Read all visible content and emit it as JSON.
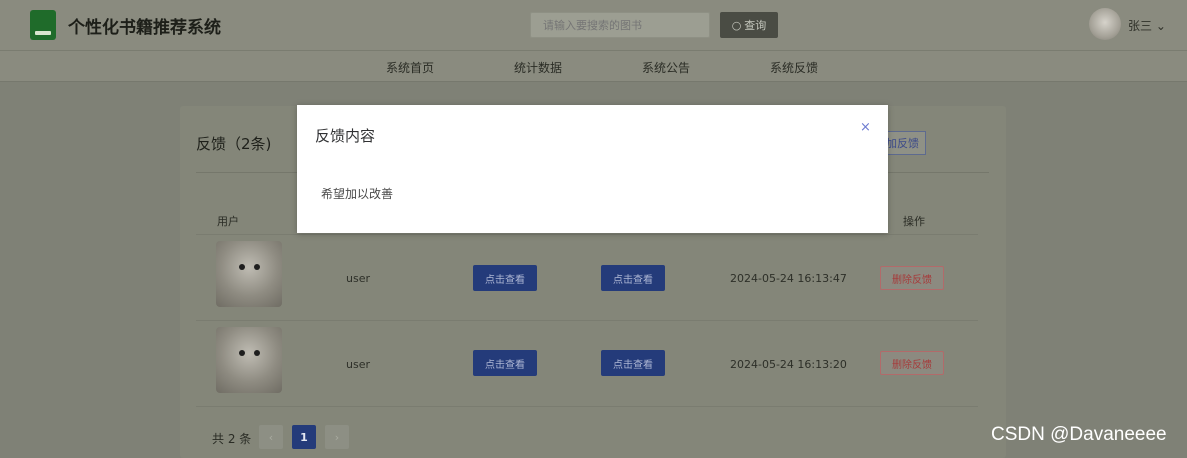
{
  "header": {
    "app_title": "个性化书籍推荐系统",
    "search_placeholder": "请输入要搜索的图书",
    "search_button": "查询",
    "user_name": "张三",
    "user_caret": "⌄"
  },
  "nav": {
    "items": [
      "系统首页",
      "统计数据",
      "系统公告",
      "系统反馈"
    ]
  },
  "card": {
    "title": "反馈（2条)",
    "add_button": "添加反馈",
    "columns": [
      "用户",
      "操作"
    ]
  },
  "rows": [
    {
      "user": "user",
      "view1": "点击查看",
      "view2": "点击查看",
      "time": "2024-05-24 16:13:47",
      "delete": "删除反馈"
    },
    {
      "user": "user",
      "view1": "点击查看",
      "view2": "点击查看",
      "time": "2024-05-24 16:13:20",
      "delete": "删除反馈"
    }
  ],
  "pagination": {
    "total": "共 2 条",
    "prev": "‹",
    "current": "1",
    "next": "›"
  },
  "modal": {
    "title": "反馈内容",
    "close": "×",
    "body": "希望加以改善"
  },
  "watermark": "CSDN @Davaneeee",
  "colors": {
    "accent": "#243b7a",
    "danger": "#a63a3a",
    "logo": "#1f6b2a"
  }
}
